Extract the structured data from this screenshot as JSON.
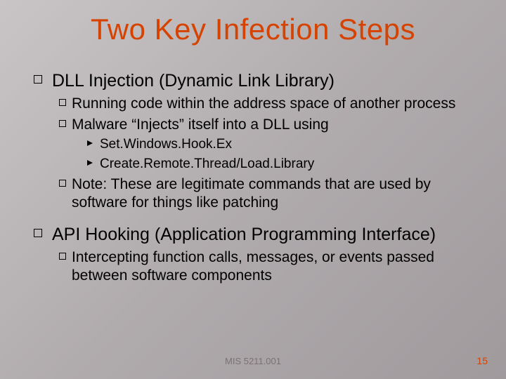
{
  "title": "Two Key Infection Steps",
  "section1": {
    "heading": "DLL Injection (Dynamic Link Library)",
    "sub1": "Running code within the address space of another process",
    "sub2": "Malware “Injects” itself into a DLL using",
    "sub2a": "Set.Windows.Hook.Ex",
    "sub2b": "Create.Remote.Thread/Load.Library",
    "sub3": "Note: These are legitimate commands that are used by software for things like patching"
  },
  "section2": {
    "heading": "API Hooking (Application Programming Interface)",
    "sub1": "Intercepting function calls, messages, or events passed between software components"
  },
  "footer": {
    "course": "MIS 5211.001",
    "page": "15"
  }
}
